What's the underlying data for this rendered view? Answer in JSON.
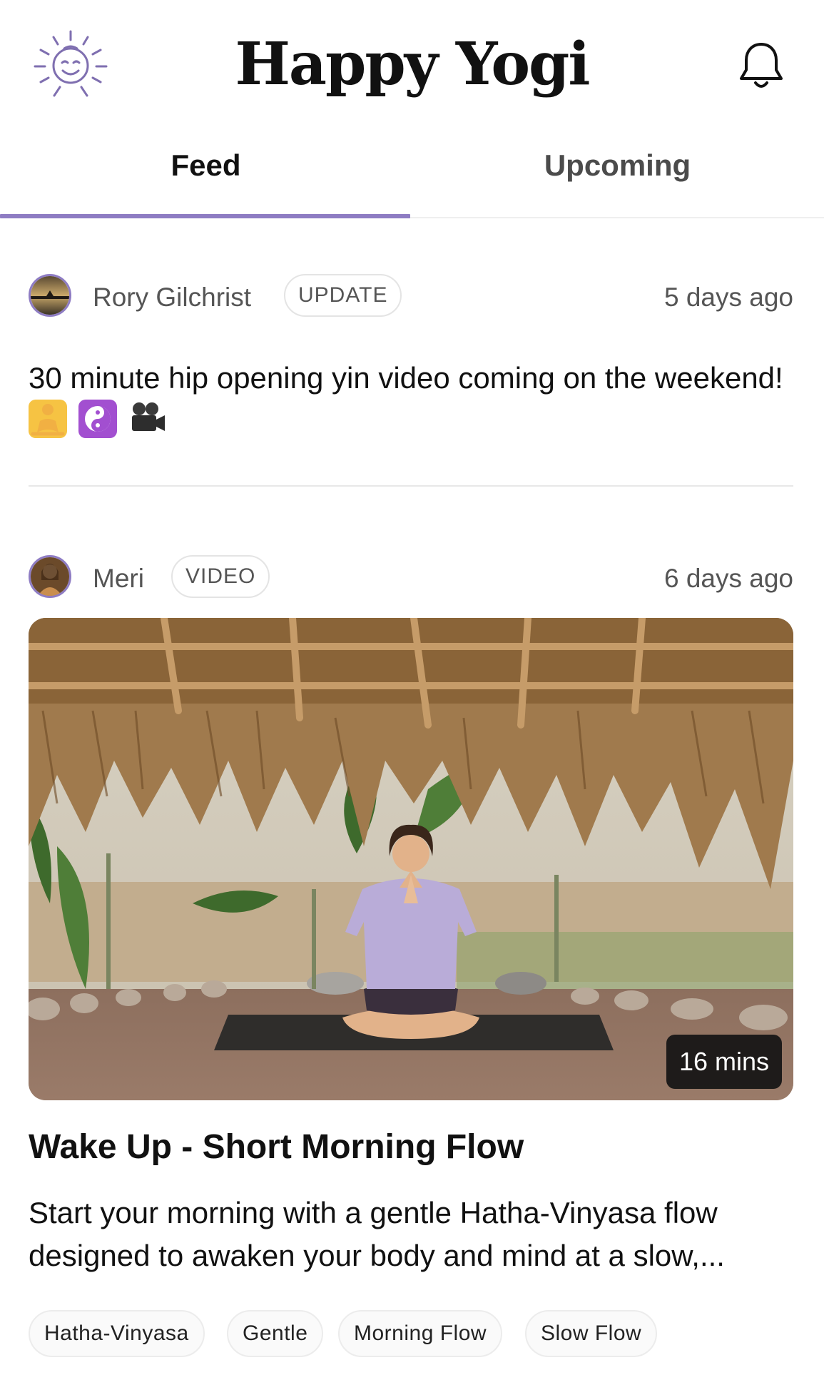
{
  "header": {
    "title": "Happy Yogi",
    "logo_icon": "smiling-sun-icon",
    "notifications_icon": "bell-icon"
  },
  "tabs": [
    {
      "label": "Feed",
      "active": true
    },
    {
      "label": "Upcoming",
      "active": false
    }
  ],
  "accent_color": "#8e7cc3",
  "posts": [
    {
      "author": "Rory Gilchrist",
      "type": "UPDATE",
      "time": "5 days ago",
      "text": "30 minute hip opening yin video coming on the weekend!",
      "emojis": [
        "person-in-lotus-position",
        "yin-yang",
        "movie-camera"
      ]
    },
    {
      "author": "Meri",
      "type": "VIDEO",
      "time": "6 days ago",
      "video": {
        "duration": "16 mins",
        "title": "Wake Up - Short Morning Flow",
        "description": "Start your morning with a gentle Hatha-Vinyasa flow designed to awaken your body and mind at a slow,...",
        "tags": [
          "Hatha-Vinyasa",
          "Gentle",
          "Morning Flow",
          "Slow Flow"
        ]
      }
    }
  ]
}
